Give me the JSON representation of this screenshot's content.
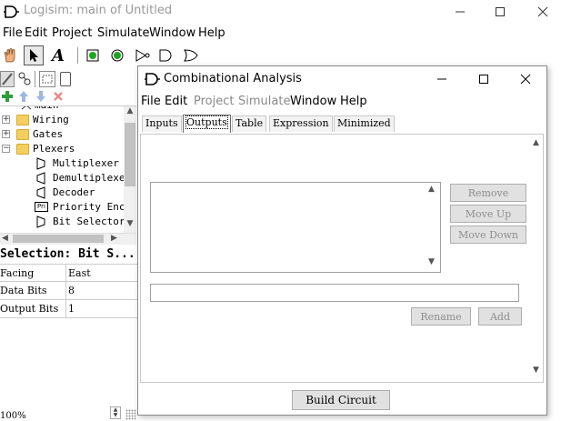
{
  "main": {
    "title": "Logisim: main of Untitled",
    "menu": [
      "File",
      "Edit",
      "Project",
      "Simulate",
      "Window",
      "Help"
    ],
    "tree": {
      "items": [
        {
          "label": "main",
          "kind": "circuit"
        },
        {
          "label": "Wiring",
          "kind": "folder",
          "expander": "+"
        },
        {
          "label": "Gates",
          "kind": "folder",
          "expander": "+"
        },
        {
          "label": "Plexers",
          "kind": "folder",
          "expander": "−"
        },
        {
          "label": "Multiplexer",
          "kind": "component"
        },
        {
          "label": "Demultiplexer",
          "kind": "component"
        },
        {
          "label": "Decoder",
          "kind": "component"
        },
        {
          "label": "Priority Encoder",
          "kind": "component",
          "icon_text": "Pri"
        },
        {
          "label": "Bit Selector",
          "kind": "component"
        }
      ]
    },
    "selection_title": "Selection: Bit S...",
    "attributes": [
      {
        "key": "Facing",
        "value": "East"
      },
      {
        "key": "Data Bits",
        "value": "8"
      },
      {
        "key": "Output Bits",
        "value": "1"
      }
    ],
    "zoom": "100%"
  },
  "dialog": {
    "title": "Combinational Analysis",
    "menu": [
      {
        "label": "File",
        "enabled": true
      },
      {
        "label": "Edit",
        "enabled": true
      },
      {
        "label": "Project",
        "enabled": false
      },
      {
        "label": "Simulate",
        "enabled": false
      },
      {
        "label": "Window",
        "enabled": true
      },
      {
        "label": "Help",
        "enabled": true
      }
    ],
    "tabs": [
      "Inputs",
      "Outputs",
      "Table",
      "Expression",
      "Minimized"
    ],
    "active_tab": "Outputs",
    "buttons": {
      "remove": "Remove",
      "move_up": "Move Up",
      "move_down": "Move Down",
      "rename": "Rename",
      "add": "Add",
      "build": "Build Circuit"
    },
    "name_field_value": ""
  },
  "colors": {
    "add_green": "#2e9e3a",
    "sim_green": "#1fa61f",
    "arrow_blue": "#9cb7e0",
    "delete_red": "#e58a8a",
    "folder": "#f4cf5f"
  }
}
